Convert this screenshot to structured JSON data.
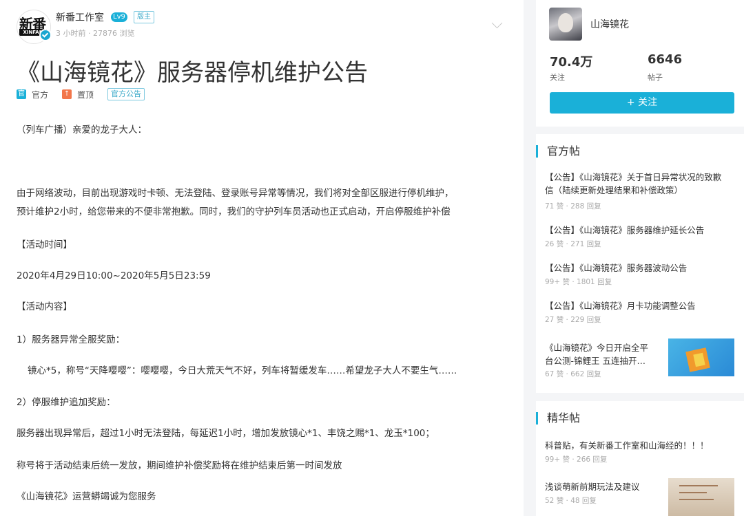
{
  "post": {
    "author": "新番工作室",
    "level": "Lv9",
    "role_badge": "版主",
    "meta": "3 小时前 · 27876 浏览",
    "title": "《山海镜花》服务器停机维护公告",
    "tags": [
      {
        "icon": "官",
        "label": "官方",
        "color": "#1ab0d8"
      },
      {
        "icon": "↑",
        "label": "置顶",
        "color": "#f2764a"
      }
    ],
    "tag_box": "官方公告",
    "paragraphs": [
      "（列车广播）亲爱的龙子大人：",
      "由于网络波动，目前出现游戏时卡顿、无法登陆、登录账号异常等情况，我们将对全部区服进行停机维护，",
      "预计维护2小时，给您带来的不便非常抱歉。同时，我们的守护列车员活动也正式启动，开启停服维护补偿",
      "【活动时间】",
      "2020年4月29日10:00~2020年5月5日23:59",
      "【活动内容】",
      "1）服务器异常全服奖励：",
      "镜心*5，称号“天降嘤嘤”：嘤嘤嘤，今日大荒天气不好，列车将暂缓发车……希望龙子大人不要生气……",
      "2）停服维护追加奖励：",
      "服务器出现异常后，超过1小时无法登陆，每延迟1小时，增加发放镜心*1、丰饶之赐*1、龙玉*100；",
      "称号将于活动结束后统一发放，期间维护补偿奖励将在维护结束后第一时间发放",
      "《山海镜花》运营蟒竭诚为您服务"
    ]
  },
  "sidebar": {
    "user": {
      "name": "山海镜花",
      "followers": "70.4万",
      "followers_label": "关注",
      "posts": "6646",
      "posts_label": "帖子",
      "follow_button": "+ 关注"
    },
    "official": {
      "heading": "官方帖",
      "items": [
        {
          "title_l1": "【公告】《山海镜花》关于首日异常状况的致歉",
          "title_l2": "信（陆续更新处理结果和补偿政策）",
          "meta": "71 赞 · 288 回复"
        },
        {
          "title_l1": "【公告】《山海镜花》服务器维护延长公告",
          "meta": "26 赞 · 271 回复"
        },
        {
          "title_l1": "【公告】《山海镜花》服务器波动公告",
          "meta": "99+ 赞 · 1801 回复"
        },
        {
          "title_l1": "【公告】《山海镜花》月卡功能调整公告",
          "meta": "27 赞 · 229 回复"
        },
        {
          "title_l1": "《山海镜花》今日开启全平",
          "title_l2": "台公测-锦鲤王 五连抽开…",
          "meta": "67 赞 · 662 回复"
        }
      ]
    },
    "featured": {
      "heading": "精华帖",
      "items": [
        {
          "title_l1": "科普贴，有关新番工作室和山海经的！！！",
          "meta": "99+ 赞 · 266 回复"
        },
        {
          "title_l1": "浅谈萌新前期玩法及建议",
          "meta": "52 赞 · 48 回复"
        }
      ]
    }
  }
}
